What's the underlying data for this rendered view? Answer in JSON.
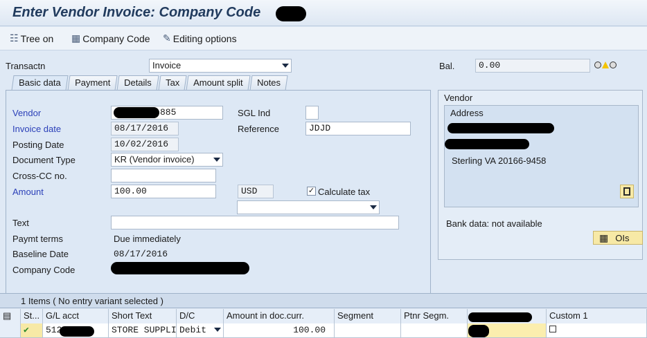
{
  "window": {
    "title": "Enter Vendor Invoice: Company Code"
  },
  "toolbar": {
    "tree_on": "Tree on",
    "company_code": "Company Code",
    "editing_options": "Editing options"
  },
  "header": {
    "transaction_label": "Transactn",
    "transaction_value": "Invoice",
    "balance_label": "Bal.",
    "balance_value": "0.00"
  },
  "tabs": [
    {
      "label": "Basic data",
      "active": true
    },
    {
      "label": "Payment"
    },
    {
      "label": "Details"
    },
    {
      "label": "Tax"
    },
    {
      "label": "Amount split"
    },
    {
      "label": "Notes"
    }
  ],
  "form": {
    "vendor_label": "Vendor",
    "vendor_value": "885",
    "sgl_label": "SGL Ind",
    "invoice_date_label": "Invoice date",
    "invoice_date_value": "08/17/2016",
    "reference_label": "Reference",
    "reference_value": "JDJD",
    "posting_date_label": "Posting Date",
    "posting_date_value": "10/02/2016",
    "doc_type_label": "Document Type",
    "doc_type_value": "KR (Vendor invoice)",
    "cross_cc_label": "Cross-CC no.",
    "amount_label": "Amount",
    "amount_value": "100.00",
    "currency_value": "USD",
    "calc_tax_label": "Calculate tax",
    "text_label": "Text",
    "payment_terms_label": "Paymt terms",
    "payment_terms_value": "Due immediately",
    "baseline_label": "Baseline Date",
    "baseline_value": "08/17/2016",
    "company_code_label": "Company Code"
  },
  "vendor_panel": {
    "title": "Vendor",
    "address_title": "Address",
    "city_line": "Sterling VA  20166-9458",
    "bank_data": "Bank data: not available",
    "ois_button": "OIs"
  },
  "items": {
    "summary": "1 Items ( No entry variant selected )",
    "columns": [
      "St...",
      "G/L acct",
      "Short Text",
      "D/C",
      "Amount in doc.curr.",
      "Segment",
      "Ptnr Segm.",
      "",
      "Custom 1"
    ],
    "rows": [
      {
        "gl": "512",
        "short_text": "STORE SUPPLI",
        "dc": "Debit",
        "amount": "100.00"
      }
    ]
  }
}
